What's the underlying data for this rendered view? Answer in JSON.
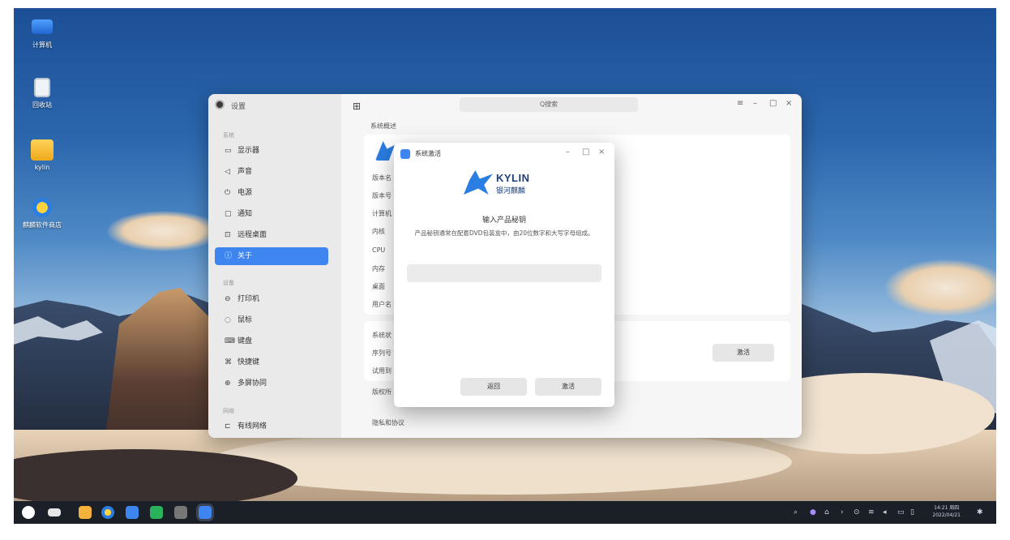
{
  "desktop": {
    "icons": [
      {
        "label": "计算机",
        "icon": "computer-icon"
      },
      {
        "label": "回收站",
        "icon": "trash-icon"
      },
      {
        "label": "kylin",
        "icon": "folder-icon"
      },
      {
        "label": "麒麟软件商店",
        "icon": "app-store-icon"
      }
    ]
  },
  "settings": {
    "title": "设置",
    "search_placeholder": "Q搜索",
    "groups": {
      "system": "系统",
      "devices": "设备",
      "network": "网络"
    },
    "nav": {
      "display": "显示器",
      "sound": "声音",
      "power": "电源",
      "notify": "通知",
      "remote": "远程桌面",
      "about": "关于",
      "printer": "打印机",
      "mouse": "鼠标",
      "keyboard": "键盘",
      "shortcut": "快捷键",
      "multiscreen": "多屏协同",
      "wired": "有线网络"
    },
    "content": {
      "section_title": "系统概述",
      "rows": {
        "version_name": "版本名",
        "version_no": "版本号",
        "computer": "计算机",
        "kernel": "内核",
        "cpu": "CPU",
        "memory": "内存",
        "desktop": "桌面",
        "user": "用户名",
        "sys_act": "系统状",
        "serial": "序列号",
        "trial": "试用到",
        "copyright": "版权所",
        "privacy": "隐私和协议"
      },
      "activate_label": "激活"
    }
  },
  "dialog": {
    "title": "系统激活",
    "logo_text": "KYLIN",
    "logo_sub": "银河麒麟",
    "heading": "输入产品秘钥",
    "description": "产品秘钥通常在配套DVD包装盒中，由20位数字和大写字母组成。",
    "input_value": "",
    "back_label": "返回",
    "activate_label": "激活"
  },
  "taskbar": {
    "time": "14:21 周四",
    "date": "2022/04/21"
  }
}
